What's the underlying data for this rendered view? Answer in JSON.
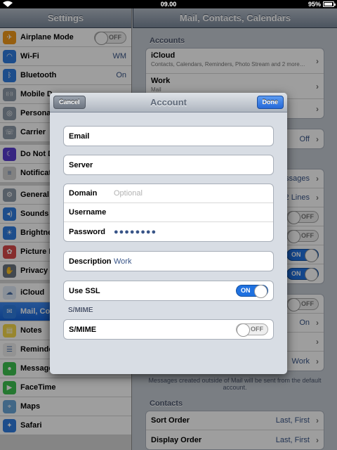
{
  "status_bar": {
    "time": "09.00",
    "battery": "95%"
  },
  "master": {
    "title": "Settings",
    "groups": [
      [
        {
          "label": "Airplane Mode",
          "toggle": "OFF",
          "icon": "airplane-icon",
          "color": "#f29a1a"
        },
        {
          "label": "Wi-Fi",
          "value": "WM",
          "icon": "wifi-icon",
          "color": "#2f7de1"
        },
        {
          "label": "Bluetooth",
          "value": "On",
          "icon": "bluetooth-icon",
          "color": "#2f7de1"
        },
        {
          "label": "Mobile D",
          "icon": "cellular-icon",
          "color": "#8d9aa8"
        },
        {
          "label": "Persona",
          "icon": "hotspot-icon",
          "color": "#8d9aa8"
        },
        {
          "label": "Carrier",
          "icon": "phone-icon",
          "color": "#8d9aa8"
        }
      ],
      [
        {
          "label": "Do Not D",
          "icon": "moon-icon",
          "color": "#5a3dd1"
        },
        {
          "label": "Notificat",
          "icon": "notifications-icon",
          "color": "#d0d0d0"
        }
      ],
      [
        {
          "label": "General",
          "icon": "gear-icon",
          "color": "#8d9aa8"
        },
        {
          "label": "Sounds",
          "icon": "speaker-icon",
          "color": "#2f7de1"
        },
        {
          "label": "Brightne",
          "icon": "brightness-icon",
          "color": "#2f7de1"
        },
        {
          "label": "Picture F",
          "icon": "flower-icon",
          "color": "#d94a4a"
        },
        {
          "label": "Privacy",
          "icon": "hand-icon",
          "color": "#6b7580"
        }
      ],
      [
        {
          "label": "iCloud",
          "icon": "cloud-icon",
          "color": "#dfe9f5"
        },
        {
          "label": "Mail, Co",
          "icon": "mail-icon",
          "color": "#2f7de1",
          "selected": true
        },
        {
          "label": "Notes",
          "icon": "notes-icon",
          "color": "#f6d84a"
        },
        {
          "label": "Reminde",
          "icon": "reminders-icon",
          "color": "#eeeeee"
        },
        {
          "label": "Messages",
          "icon": "messages-icon",
          "color": "#3cc24f"
        },
        {
          "label": "FaceTime",
          "icon": "facetime-icon",
          "color": "#3cc24f"
        },
        {
          "label": "Maps",
          "icon": "maps-icon",
          "color": "#6aa6d8"
        },
        {
          "label": "Safari",
          "icon": "safari-icon",
          "color": "#2f7de1"
        }
      ]
    ]
  },
  "detail": {
    "title": "Mail, Contacts, Calendars",
    "accounts_header": "Accounts",
    "accounts": [
      {
        "label": "iCloud",
        "sub": "Contacts, Calendars, Reminders, Photo Stream and 2 more…"
      },
      {
        "label": "Work",
        "sub": "Mail"
      }
    ],
    "fetch_value": "Off",
    "mail_values": [
      "ssages",
      "2 Lines"
    ],
    "toggles": [
      "OFF",
      "OFF",
      "ON",
      "ON"
    ],
    "lower_toggles": [
      "OFF"
    ],
    "lower_values": [
      "On",
      "",
      "Work"
    ],
    "note": "Messages created outside of Mail will be sent from the default account.",
    "contacts_header": "Contacts",
    "contacts": [
      {
        "label": "Sort Order",
        "value": "Last, First"
      },
      {
        "label": "Display Order",
        "value": "Last, First"
      }
    ]
  },
  "modal": {
    "title": "Account",
    "cancel": "Cancel",
    "done": "Done",
    "email_label": "Email",
    "server_label": "Server",
    "domain_label": "Domain",
    "domain_placeholder": "Optional",
    "username_label": "Username",
    "password_label": "Password",
    "password_mask": "●●●●●●●●",
    "description_label": "Description",
    "description_value": "Work",
    "ssl_label": "Use SSL",
    "ssl_state": "ON",
    "smime_header": "S/MIME",
    "smime_label": "S/MIME",
    "smime_state": "OFF"
  }
}
